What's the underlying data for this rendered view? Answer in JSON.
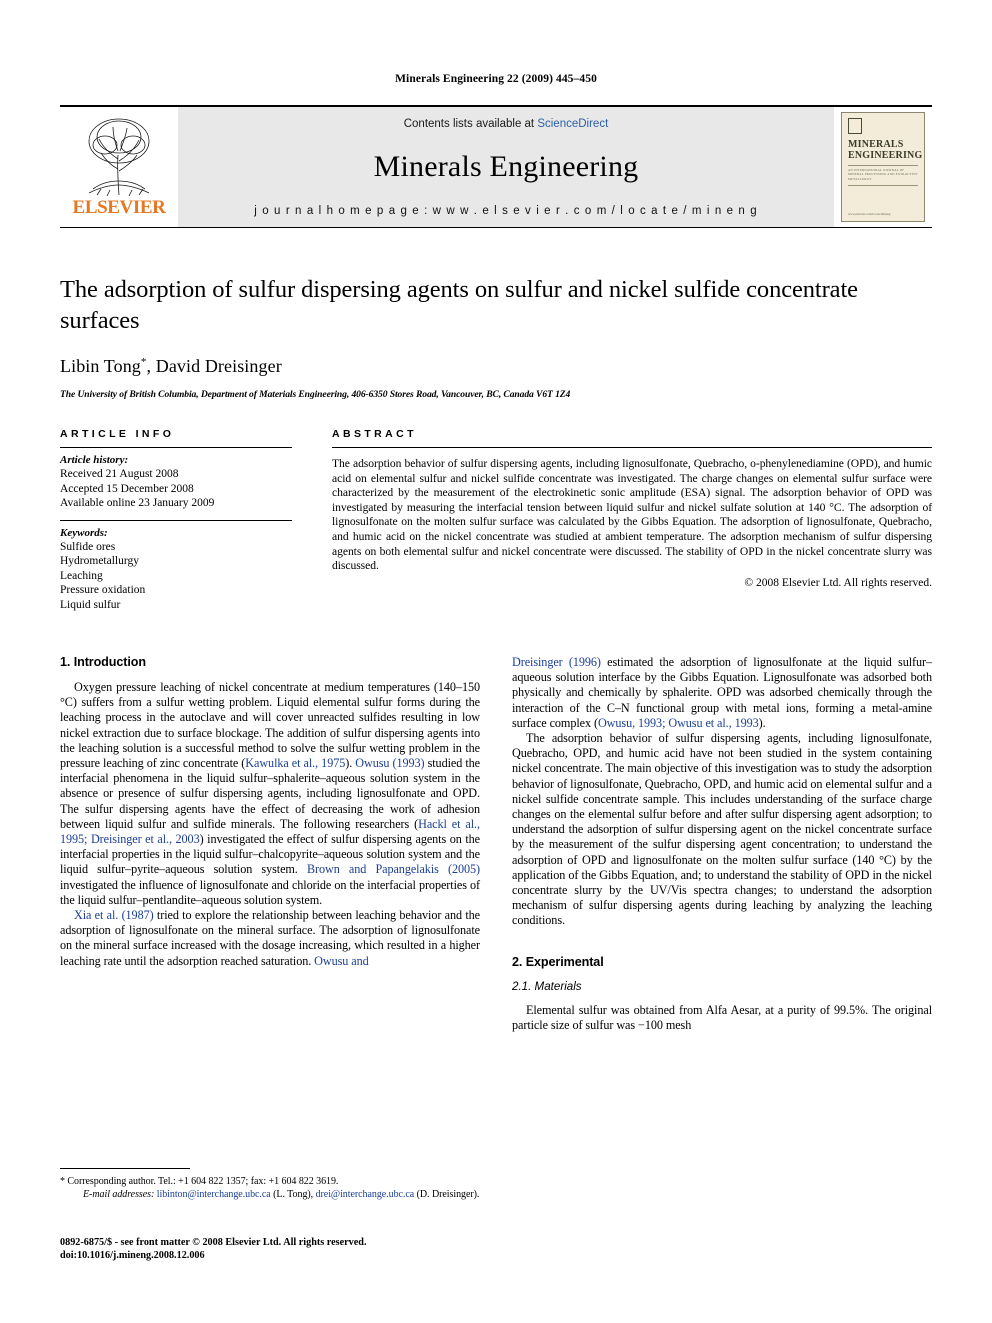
{
  "running_head": "Minerals Engineering 22 (2009) 445–450",
  "masthead": {
    "publisher_name": "ELSEVIER",
    "contents_prefix": "Contents lists available at ",
    "contents_link": "ScienceDirect",
    "journal_title": "Minerals Engineering",
    "homepage": "j o u r n a l   h o m e p a g e :   w w w . e l s e v i e r . c o m / l o c a t e / m i n e n g",
    "cover": {
      "line1": "MINERALS",
      "line2": "ENGINEERING",
      "subtitle": "AN INTERNATIONAL JOURNAL OF MINERAL PROCESSING AND EXTRACTIVE METALLURGY",
      "footer": "www.elsevier.com/locate/mineng"
    },
    "link_color": "#2b5fa8",
    "brand_color": "#E87722"
  },
  "article": {
    "title": "The adsorption of sulfur dispersing agents on sulfur and nickel sulfide concentrate surfaces",
    "authors": "Libin Tong",
    "authors_marker": "*",
    "authors_rest": ", David Dreisinger",
    "affiliation": "The University of British Columbia, Department of Materials Engineering, 406-6350 Stores Road, Vancouver, BC, Canada V6T 1Z4"
  },
  "article_info": {
    "label": "ARTICLE INFO",
    "history_label": "Article history:",
    "history": [
      "Received 21 August 2008",
      "Accepted 15 December 2008",
      "Available online 23 January 2009"
    ],
    "keywords_label": "Keywords:",
    "keywords": [
      "Sulfide ores",
      "Hydrometallurgy",
      "Leaching",
      "Pressure oxidation",
      "Liquid sulfur"
    ]
  },
  "abstract": {
    "label": "ABSTRACT",
    "text": "The adsorption behavior of sulfur dispersing agents, including lignosulfonate, Quebracho, o-phenylenediamine (OPD), and humic acid on elemental sulfur and nickel sulfide concentrate was investigated. The charge changes on elemental sulfur surface were characterized by the measurement of the electrokinetic sonic amplitude (ESA) signal. The adsorption behavior of OPD was investigated by measuring the interfacial tension between liquid sulfur and nickel sulfate solution at 140 °C. The adsorption of lignosulfonate on the molten sulfur surface was calculated by the Gibbs Equation. The adsorption of lignosulfonate, Quebracho, and humic acid on the nickel concentrate was studied at ambient temperature. The adsorption mechanism of sulfur dispersing agents on both elemental sulfur and nickel concentrate were discussed. The stability of OPD in the nickel concentrate slurry was discussed.",
    "copyright": "© 2008 Elsevier Ltd. All rights reserved."
  },
  "sections": {
    "introduction_heading": "1. Introduction",
    "experimental_heading": "2. Experimental",
    "materials_heading": "2.1. Materials"
  },
  "left_column": {
    "para1_a": "Oxygen pressure leaching of nickel concentrate at medium temperatures (140–150 °C) suffers from a sulfur wetting problem. Liquid elemental sulfur forms during the leaching process in the autoclave and will cover unreacted sulfides resulting in low nickel extraction due to surface blockage. The addition of sulfur dispersing agents into the leaching solution is a successful method to solve the sulfur wetting problem in the pressure leaching of zinc concentrate (",
    "cite1": "Kawulka et al., 1975",
    "para1_b": "). ",
    "cite2": "Owusu (1993)",
    "para1_c": " studied the interfacial phenomena in the liquid sulfur–sphalerite–aqueous solution system in the absence or presence of sulfur dispersing agents, including lignosulfonate and OPD. The sulfur dispersing agents have the effect of decreasing the work of adhesion between liquid sulfur and sulfide minerals. The following researchers (",
    "cite3": "Hackl et al., 1995; Dreisinger et al., 2003",
    "para1_d": ") investigated the effect of sulfur dispersing agents on the interfacial properties in the liquid sulfur–chalcopyrite–aqueous solution system and the liquid sulfur–pyrite–aqueous solution system. ",
    "cite4": "Brown and Papangelakis (2005)",
    "para1_e": " investigated the influence of lignosulfonate and chloride on the interfacial properties of the liquid sulfur–pentlandite–aqueous solution system.",
    "para2_a": "",
    "cite5": "Xia et al. (1987)",
    "para2_b": " tried to explore the relationship between leaching behavior and the adsorption of lignosulfonate on the mineral surface. The adsorption of lignosulfonate on the mineral surface increased with the dosage increasing, which resulted in a higher leaching rate until the adsorption reached saturation. ",
    "cite6": "Owusu and"
  },
  "right_column": {
    "para_a_cite": "Dreisinger (1996)",
    "para_a": " estimated the adsorption of lignosulfonate at the liquid sulfur–aqueous solution interface by the Gibbs Equation. Lignosulfonate was adsorbed both physically and chemically by sphalerite. OPD was adsorbed chemically through the interaction of the C–N functional group with metal ions, forming a metal-amine surface complex (",
    "para_a_cite2": "Owusu, 1993; Owusu et al., 1993",
    "para_a_end": ").",
    "para_b": "The adsorption behavior of sulfur dispersing agents, including lignosulfonate, Quebracho, OPD, and humic acid have not been studied in the system containing nickel concentrate. The main objective of this investigation was to study the adsorption behavior of lignosulfonate, Quebracho, OPD, and humic acid on elemental sulfur and a nickel sulfide concentrate sample. This includes understanding of the surface charge changes on the elemental sulfur before and after sulfur dispersing agent adsorption; to understand the adsorption of sulfur dispersing agent on the nickel concentrate surface by the measurement of the sulfur dispersing agent concentration; to understand the adsorption of OPD and lignosulfonate on the molten sulfur surface (140 °C) by the application of the Gibbs Equation, and; to understand the stability of OPD in the nickel concentrate slurry by the UV/Vis spectra changes; to understand the adsorption mechanism of sulfur dispersing agents during leaching by analyzing the leaching conditions.",
    "para_c": "Elemental sulfur was obtained from Alfa Aesar, at a purity of 99.5%. The original particle size of sulfur was −100 mesh"
  },
  "footnotes": {
    "corresponding_marker": "*",
    "corresponding": " Corresponding author. Tel.: +1 604 822 1357; fax: +1 604 822 3619.",
    "email_label": "E-mail addresses:",
    "email1": "libinton@interchange.ubc.ca",
    "email1_owner": " (L. Tong), ",
    "email2": "drei@interchange.ubc.ca",
    "email2_owner": " (D. Dreisinger)."
  },
  "imprint": {
    "line1": "0892-6875/$ - see front matter © 2008 Elsevier Ltd. All rights reserved.",
    "line2": "doi:10.1016/j.mineng.2008.12.006"
  }
}
